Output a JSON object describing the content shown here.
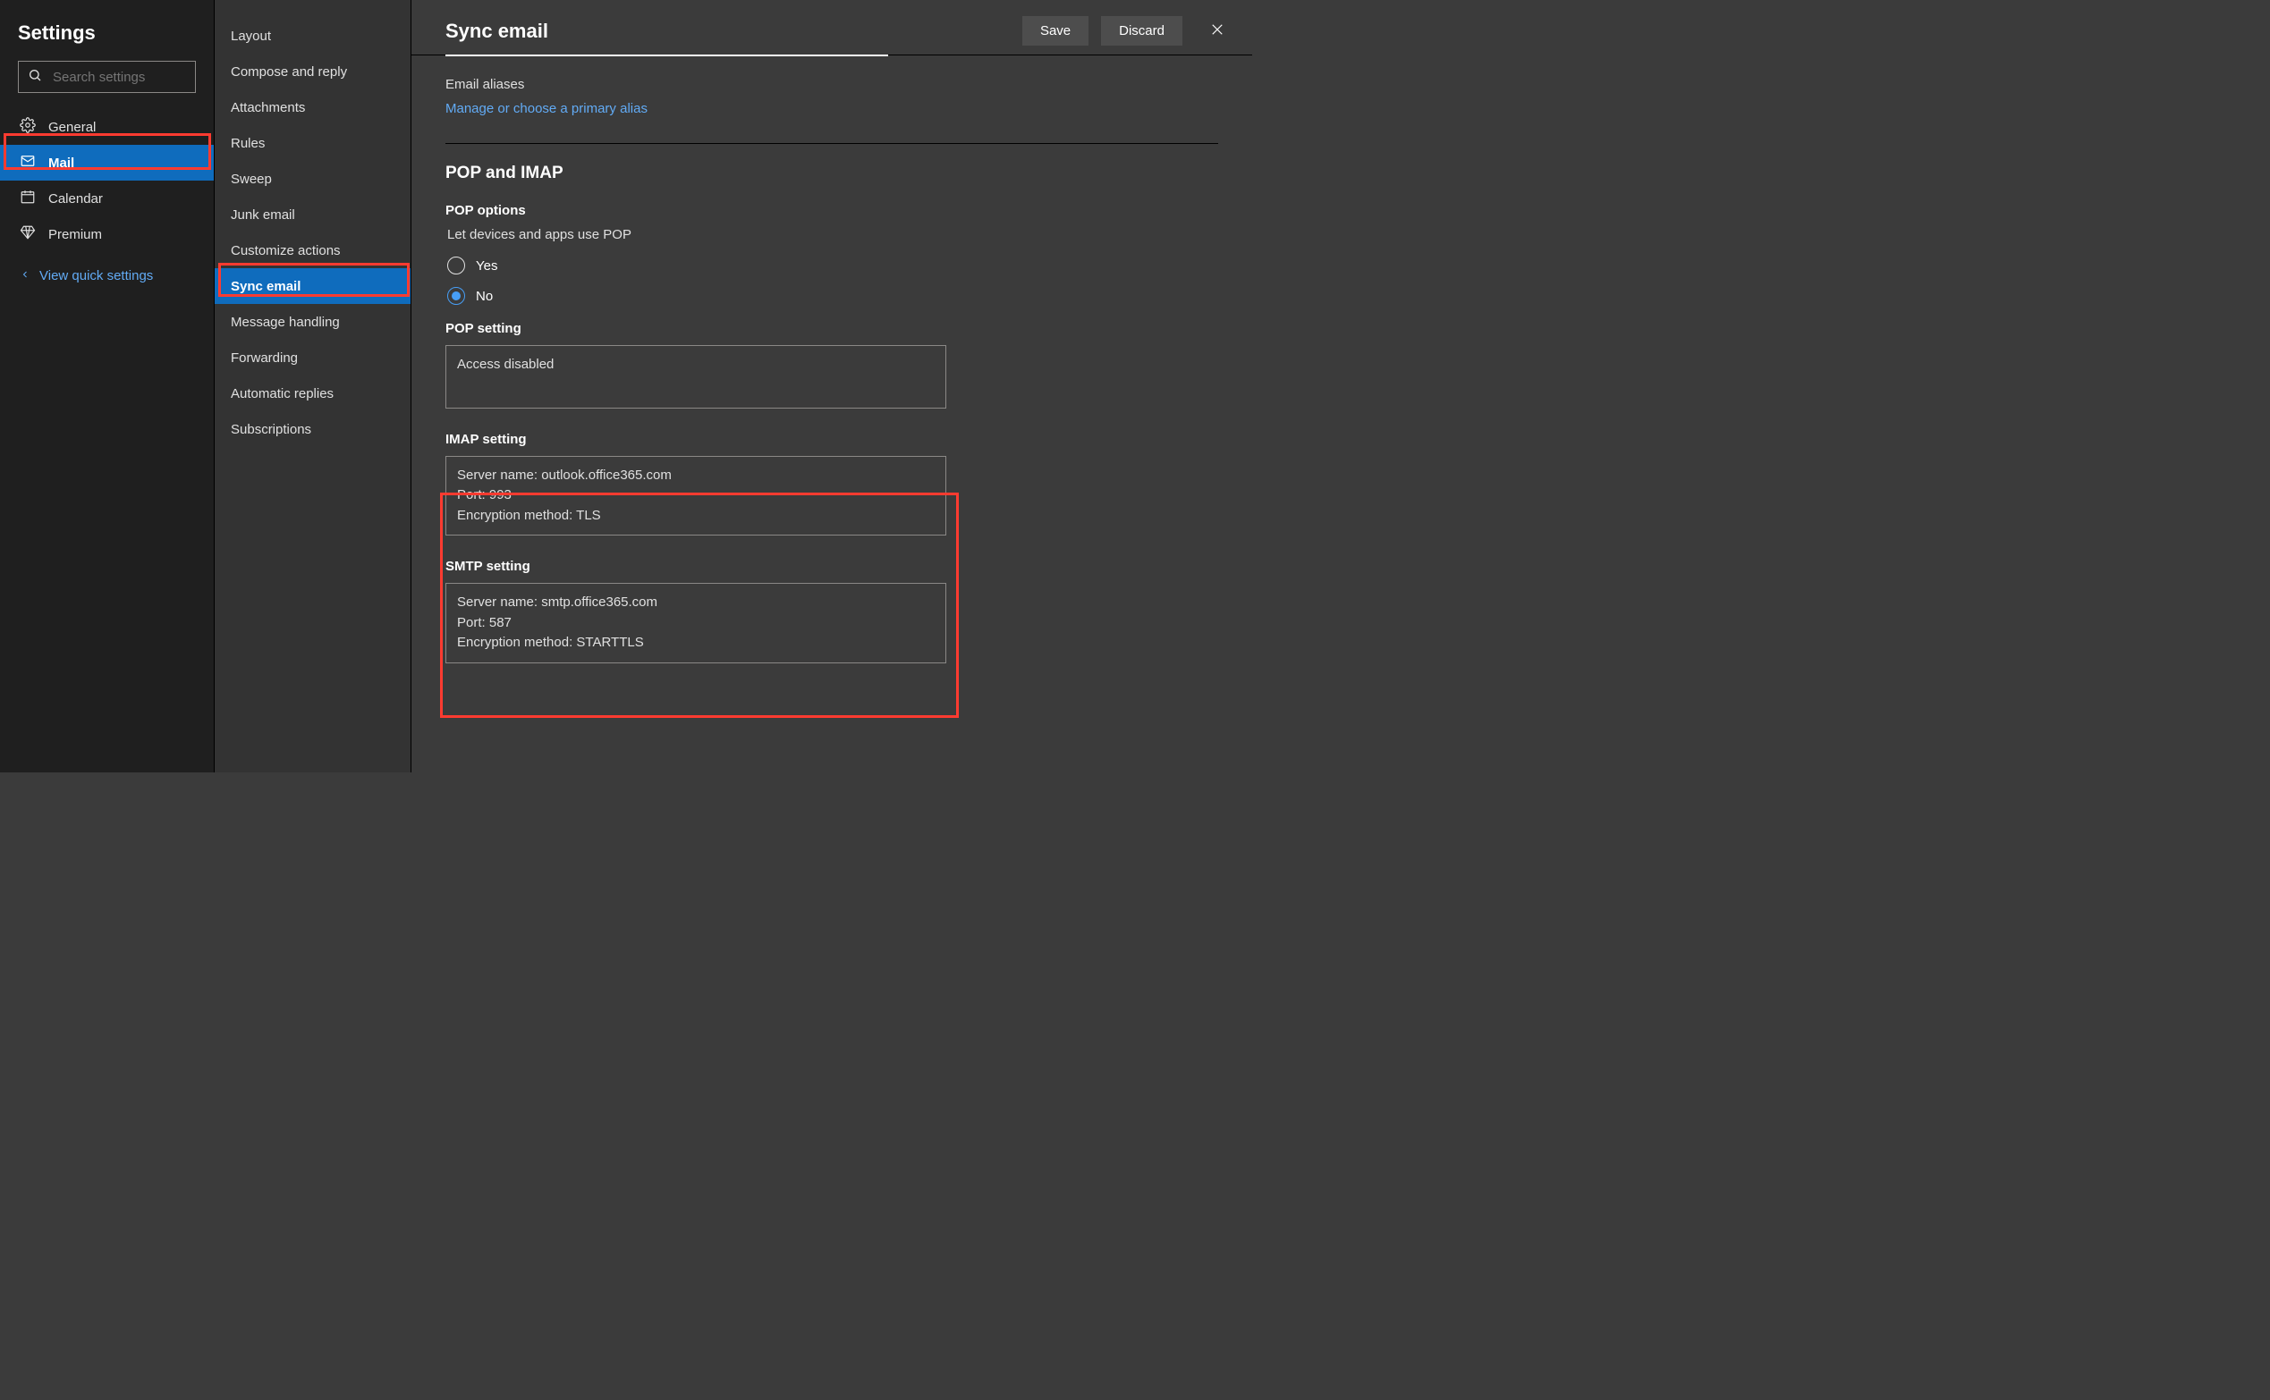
{
  "sidebar": {
    "title": "Settings",
    "search_placeholder": "Search settings",
    "items": [
      {
        "id": "general",
        "label": "General",
        "icon": "gear"
      },
      {
        "id": "mail",
        "label": "Mail",
        "icon": "mail",
        "selected": true
      },
      {
        "id": "calendar",
        "label": "Calendar",
        "icon": "calendar"
      },
      {
        "id": "premium",
        "label": "Premium",
        "icon": "diamond"
      }
    ],
    "quick_settings": "View quick settings"
  },
  "secondary": {
    "items": [
      "Layout",
      "Compose and reply",
      "Attachments",
      "Rules",
      "Sweep",
      "Junk email",
      "Customize actions",
      "Sync email",
      "Message handling",
      "Forwarding",
      "Automatic replies",
      "Subscriptions"
    ],
    "selected": "Sync email"
  },
  "header": {
    "title": "Sync email",
    "save": "Save",
    "discard": "Discard"
  },
  "content": {
    "aliases_label": "Email aliases",
    "manage_alias_link": "Manage or choose a primary alias",
    "pop_imap_head": "POP and IMAP",
    "pop_options_head": "POP options",
    "pop_options_desc": "Let devices and apps use POP",
    "radio_yes": "Yes",
    "radio_no": "No",
    "pop_setting_head": "POP setting",
    "pop_setting_value": "Access disabled",
    "imap_setting_head": "IMAP setting",
    "imap": {
      "server_label": "Server name:",
      "server": "outlook.office365.com",
      "port_label": "Port:",
      "port": "993",
      "enc_label": "Encryption method:",
      "enc": "TLS"
    },
    "smtp_setting_head": "SMTP setting",
    "smtp": {
      "server_label": "Server name:",
      "server": "smtp.office365.com",
      "port_label": "Port:",
      "port": "587",
      "enc_label": "Encryption method:",
      "enc": "STARTTLS"
    }
  }
}
